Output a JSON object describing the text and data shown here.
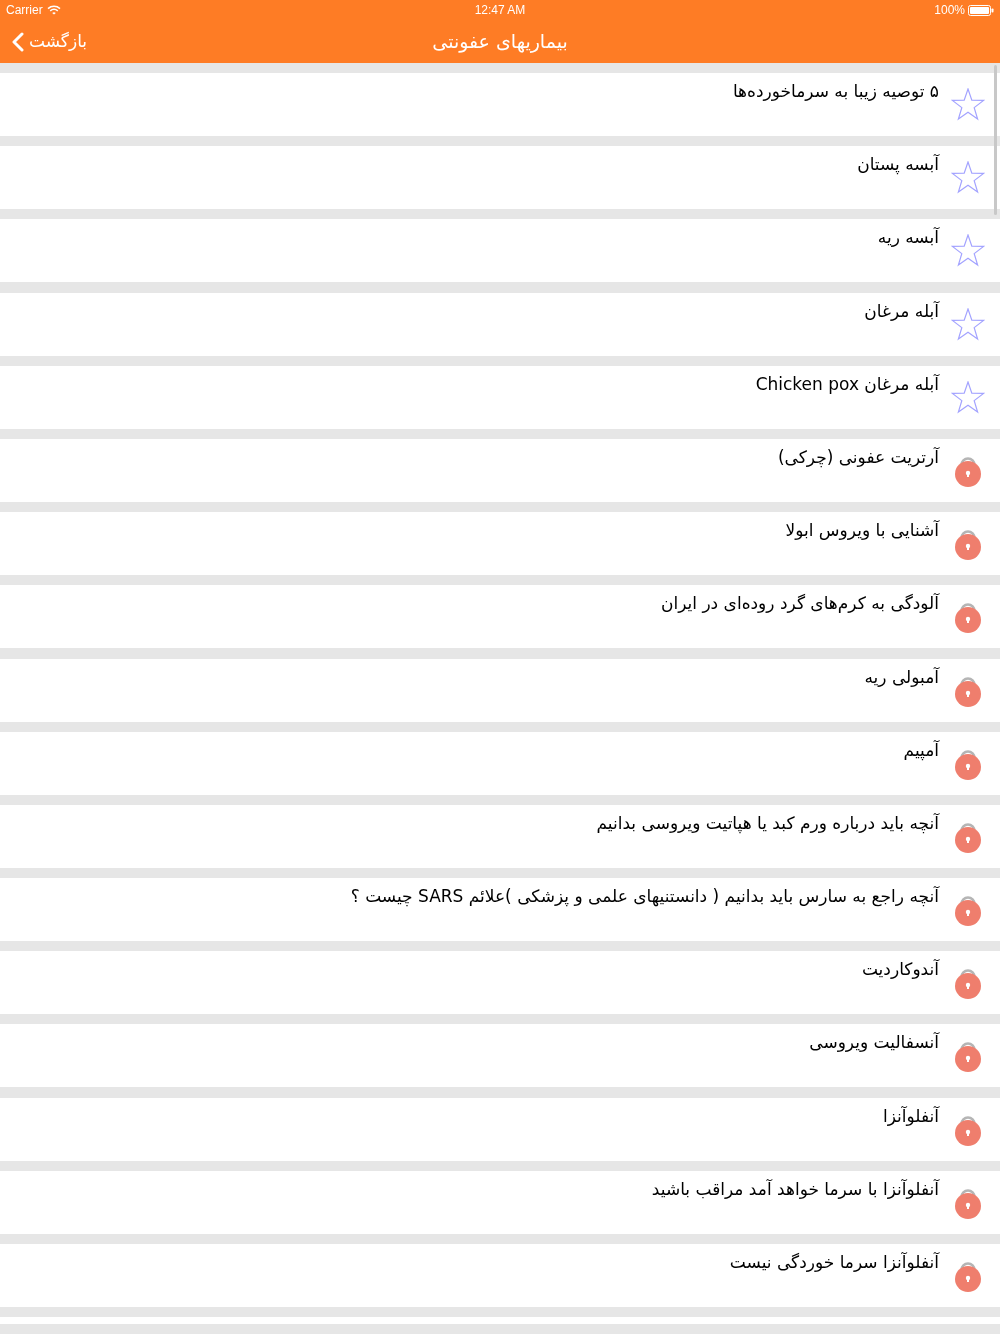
{
  "status_bar": {
    "carrier": "Carrier",
    "time": "12:47 AM",
    "battery": "100%"
  },
  "nav_bar": {
    "back_label": "بازگشت",
    "title": "بیماریهای عفونتی"
  },
  "items": [
    {
      "title": "۵ توصیه زیبا به سرماخورده‌ها",
      "kind": "star"
    },
    {
      "title": "آبسه پستان",
      "kind": "star"
    },
    {
      "title": "آبسه ریه",
      "kind": "star"
    },
    {
      "title": "آبله مرغان",
      "kind": "star"
    },
    {
      "title": "آبله مرغان Chicken pox",
      "kind": "star"
    },
    {
      "title": "آرتریت عفونی (چرکی)",
      "kind": "lock"
    },
    {
      "title": "آشنایی با ویروس ابولا",
      "kind": "lock"
    },
    {
      "title": "آلودگی به کرم‌های گرد روده‌ای در ایران",
      "kind": "lock"
    },
    {
      "title": "آمبولی ریه",
      "kind": "lock"
    },
    {
      "title": "آمپیم",
      "kind": "lock"
    },
    {
      "title": "آنچه باید درباره ورم کبد یا هپاتیت ویروسی بدانیم",
      "kind": "lock"
    },
    {
      "title": "آنچه راجع به سارس باید بدانیم ( دانستنیهای علمی و پزشکی )علائم SARS چیست ؟",
      "kind": "lock"
    },
    {
      "title": "آندوکاردیت",
      "kind": "lock"
    },
    {
      "title": "آنسفالیت ویروسی",
      "kind": "lock"
    },
    {
      "title": "آنفلوآنزا",
      "kind": "lock"
    },
    {
      "title": "آنفلوآنزا با سرما خواهد آمد مراقب باشید",
      "kind": "lock"
    },
    {
      "title": "آنفلوآنزا سرما خوردگی نیست",
      "kind": "lock"
    }
  ]
}
